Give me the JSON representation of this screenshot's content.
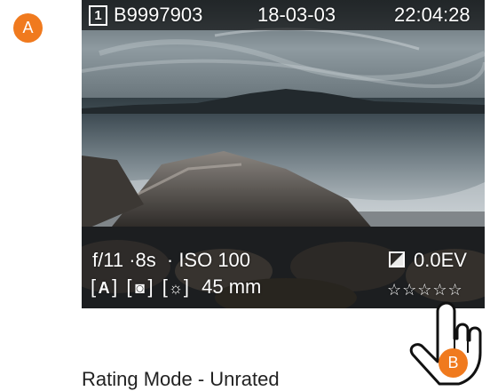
{
  "markers": {
    "a": "A",
    "b": "B"
  },
  "topbar": {
    "card_slot": "1",
    "image_id": "B9997903",
    "date": "18-03-03",
    "time": "22:04:28"
  },
  "exposure": {
    "aperture": "f/11",
    "shutter": "·8s",
    "iso": "· ISO 100",
    "ev": "0.0EV"
  },
  "modes": {
    "exposure_mode": "A",
    "metering": "◙",
    "white_balance": "☼",
    "focal_length": "45 mm"
  },
  "rating": {
    "stars_display": "☆☆☆☆☆",
    "value": 0,
    "max": 5
  },
  "caption": "Rating Mode - Unrated",
  "colors": {
    "marker": "#f07a1e",
    "osd_text": "#ffffff"
  },
  "icons": [
    "card-slot-icon",
    "ev-compensation-icon",
    "metering-icon",
    "white-balance-icon",
    "star-icon",
    "pointing-hand-icon"
  ]
}
